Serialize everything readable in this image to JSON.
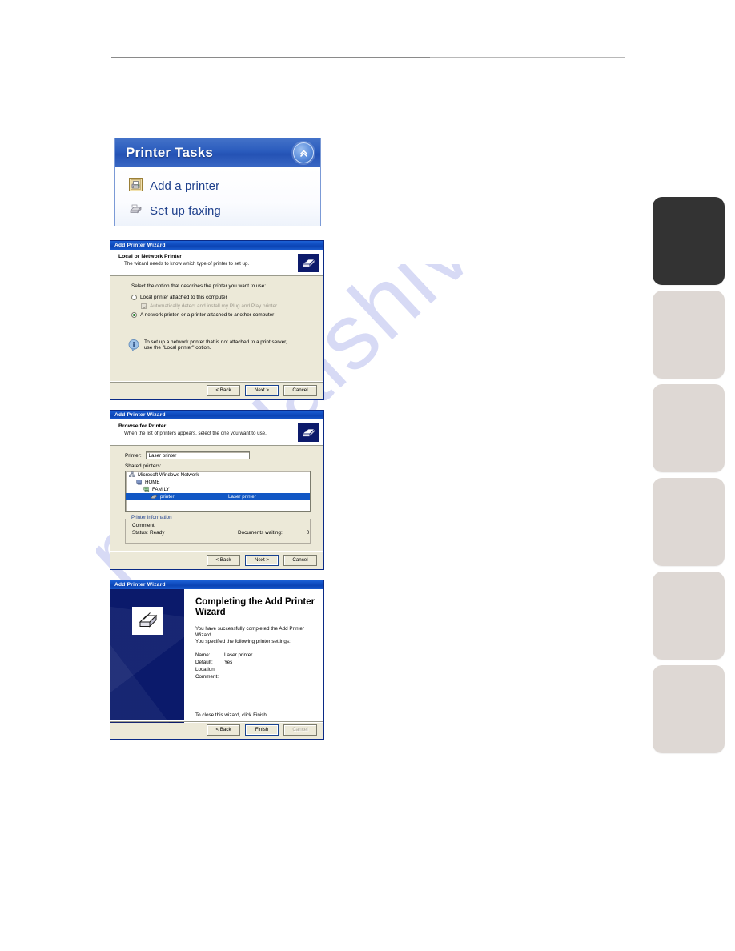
{
  "watermark": {
    "text": "manualshive.com"
  },
  "printer_tasks": {
    "title": "Printer Tasks",
    "collapse_icon": "chevron-double-up-icon",
    "items": [
      {
        "label": "Add a printer",
        "icon": "add-printer-icon"
      },
      {
        "label": "Set up faxing",
        "icon": "fax-icon"
      }
    ]
  },
  "dialog_local_or_network": {
    "window_title": "Add Printer Wizard",
    "heading": "Local or Network Printer",
    "subheading": "The wizard needs to know which type of printer to set up.",
    "prompt": "Select the option that describes the printer you want to use:",
    "options": [
      {
        "label": "Local printer attached to this computer",
        "selected": false
      },
      {
        "label": "Automatically detect and install my Plug and Play printer",
        "checkbox": true,
        "checked": true,
        "disabled": true
      },
      {
        "label": "A network printer, or a printer attached to another computer",
        "selected": true
      }
    ],
    "info_line1": "To set up a network printer that is not attached to a print server,",
    "info_line2": "use the \"Local printer\" option.",
    "buttons": {
      "back": "< Back",
      "next": "Next >",
      "cancel": "Cancel"
    }
  },
  "dialog_browse": {
    "window_title": "Add Printer Wizard",
    "heading": "Browse for Printer",
    "subheading": "When the list of printers appears, select the one you want to use.",
    "printer_label": "Printer:",
    "printer_value": "Laser printer",
    "shared_label": "Shared printers:",
    "tree": [
      {
        "label": "Microsoft Windows Network",
        "indent": 0,
        "icon": "network-icon",
        "selected": false,
        "col2": ""
      },
      {
        "label": "HOME",
        "indent": 1,
        "icon": "workgroup-icon",
        "selected": false,
        "col2": ""
      },
      {
        "label": "FAMILY",
        "indent": 2,
        "icon": "computer-icon",
        "selected": false,
        "col2": ""
      },
      {
        "label": "printer",
        "indent": 3,
        "icon": "printer-icon",
        "selected": true,
        "col2": "Laser printer"
      }
    ],
    "info_group_label": "Printer information",
    "comment_label": "Comment:",
    "comment_value": "",
    "status_label": "Status:",
    "status_value": "Ready",
    "docs_label": "Documents waiting:",
    "docs_value": "0",
    "buttons": {
      "back": "< Back",
      "next": "Next >",
      "cancel": "Cancel"
    }
  },
  "dialog_complete": {
    "window_title": "Add Printer Wizard",
    "heading": "Completing the Add Printer Wizard",
    "paragraph1": "You have successfully completed the Add Printer Wizard.",
    "paragraph2": "You specified the following printer settings:",
    "settings": [
      {
        "key": "Name:",
        "value": "Laser printer"
      },
      {
        "key": "Default:",
        "value": "Yes"
      },
      {
        "key": "Location:",
        "value": ""
      },
      {
        "key": "Comment:",
        "value": ""
      }
    ],
    "close_hint": "To close this wizard, click Finish.",
    "buttons": {
      "back": "< Back",
      "finish": "Finish",
      "cancel": "Cancel"
    }
  },
  "side_tabs": [
    {
      "active": true
    },
    {
      "active": false
    },
    {
      "active": false
    },
    {
      "active": false
    },
    {
      "active": false
    },
    {
      "active": false
    }
  ]
}
